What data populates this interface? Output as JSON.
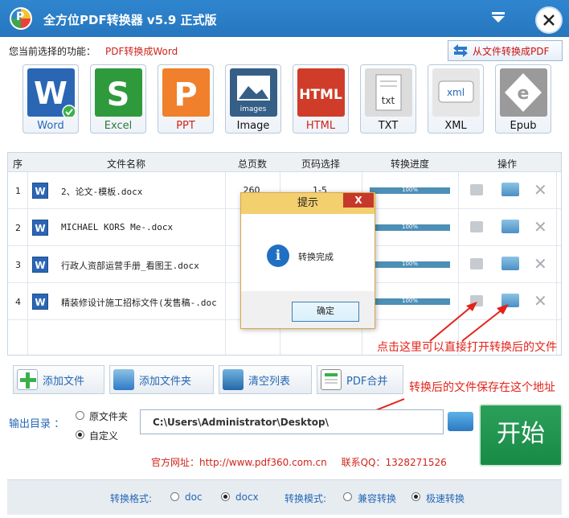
{
  "window": {
    "title": "全方位PDF转换器 v5.9 正式版",
    "logo_letter": "P"
  },
  "current_function": {
    "label": "您当前选择的功能：",
    "value": "PDF转换成Word"
  },
  "switch_button": {
    "label": "从文件转换成PDF",
    "icon": "swap-arrows-icon"
  },
  "formats": [
    {
      "label": "Word",
      "icon": "word-icon",
      "color": "#2b66b5",
      "glyph": "W",
      "selected": true
    },
    {
      "label": "Excel",
      "icon": "excel-icon",
      "color": "#2f9a3c",
      "glyph": "S"
    },
    {
      "label": "PPT",
      "icon": "ppt-icon",
      "color": "#f0802b",
      "glyph": "P"
    },
    {
      "label": "Image",
      "icon": "image-icon",
      "color": "#355f86",
      "glyph": "images"
    },
    {
      "label": "HTML",
      "icon": "html-icon",
      "color": "#cf3d2a",
      "glyph": "HTML"
    },
    {
      "label": "TXT",
      "icon": "txt-icon",
      "color": "#dcdcdc",
      "glyph": "txt"
    },
    {
      "label": "XML",
      "icon": "xml-icon",
      "color": "#e6e6e6",
      "glyph": "xml"
    },
    {
      "label": "Epub",
      "icon": "epub-icon",
      "color": "#9a9a9a",
      "glyph": "e"
    }
  ],
  "table": {
    "headers": [
      "序",
      "文件名称",
      "总页数",
      "页码选择",
      "转换进度",
      "操作"
    ],
    "rows": [
      {
        "index": "1",
        "name": "2、论文-模板.docx",
        "pages": "260",
        "page_sel": "1-5",
        "progress": 1.0,
        "progress_label": "100%"
      },
      {
        "index": "2",
        "name": "MICHAEL KORS Me-.docx",
        "pages": "",
        "page_sel": "",
        "progress": 1.0,
        "progress_label": "100%"
      },
      {
        "index": "3",
        "name": "行政人资部运营手册_看图王.docx",
        "pages": "",
        "page_sel": "",
        "progress": 1.0,
        "progress_label": "100%"
      },
      {
        "index": "4",
        "name": "精装修设计施工招标文件(发售稿-.doc",
        "pages": "",
        "page_sel": "",
        "progress": 1.0,
        "progress_label": "100%"
      }
    ]
  },
  "dialog": {
    "title": "提示",
    "close": "X",
    "message": "转换完成",
    "ok_label": "确定",
    "icon": "info-icon"
  },
  "actions": [
    {
      "label": "添加文件",
      "icon": "add-file-icon"
    },
    {
      "label": "添加文件夹",
      "icon": "add-folder-icon"
    },
    {
      "label": "清空列表",
      "icon": "recycle-bin-icon"
    },
    {
      "label": "PDF合并",
      "icon": "pdf-merge-icon"
    }
  ],
  "annotations": {
    "open_file": "点击这里可以直接打开转换后的文件",
    "save_location": "转换后的文件保存在这个地址"
  },
  "output": {
    "label": "输出目录 ：",
    "options": [
      {
        "label": "原文件夹",
        "selected": false
      },
      {
        "label": "自定义",
        "selected": true
      }
    ],
    "path": "C:\\Users\\Administrator\\Desktop\\"
  },
  "start_button": "开始",
  "footer": {
    "site": "官方网址：http://www.pdf360.com.cn",
    "qq": "联系QQ：1328271526"
  },
  "bottom": {
    "format_label": "转换格式:",
    "format_options": [
      {
        "label": "doc",
        "selected": false
      },
      {
        "label": "docx",
        "selected": true
      }
    ],
    "mode_label": "转换模式:",
    "mode_options": [
      {
        "label": "兼容转换",
        "selected": false
      },
      {
        "label": "极速转换",
        "selected": true
      }
    ]
  },
  "colors": {
    "titlebar": "#2a7bc2",
    "accent_red": "#d0231b",
    "link_blue": "#2567b5",
    "start_green": "#1f9450"
  }
}
